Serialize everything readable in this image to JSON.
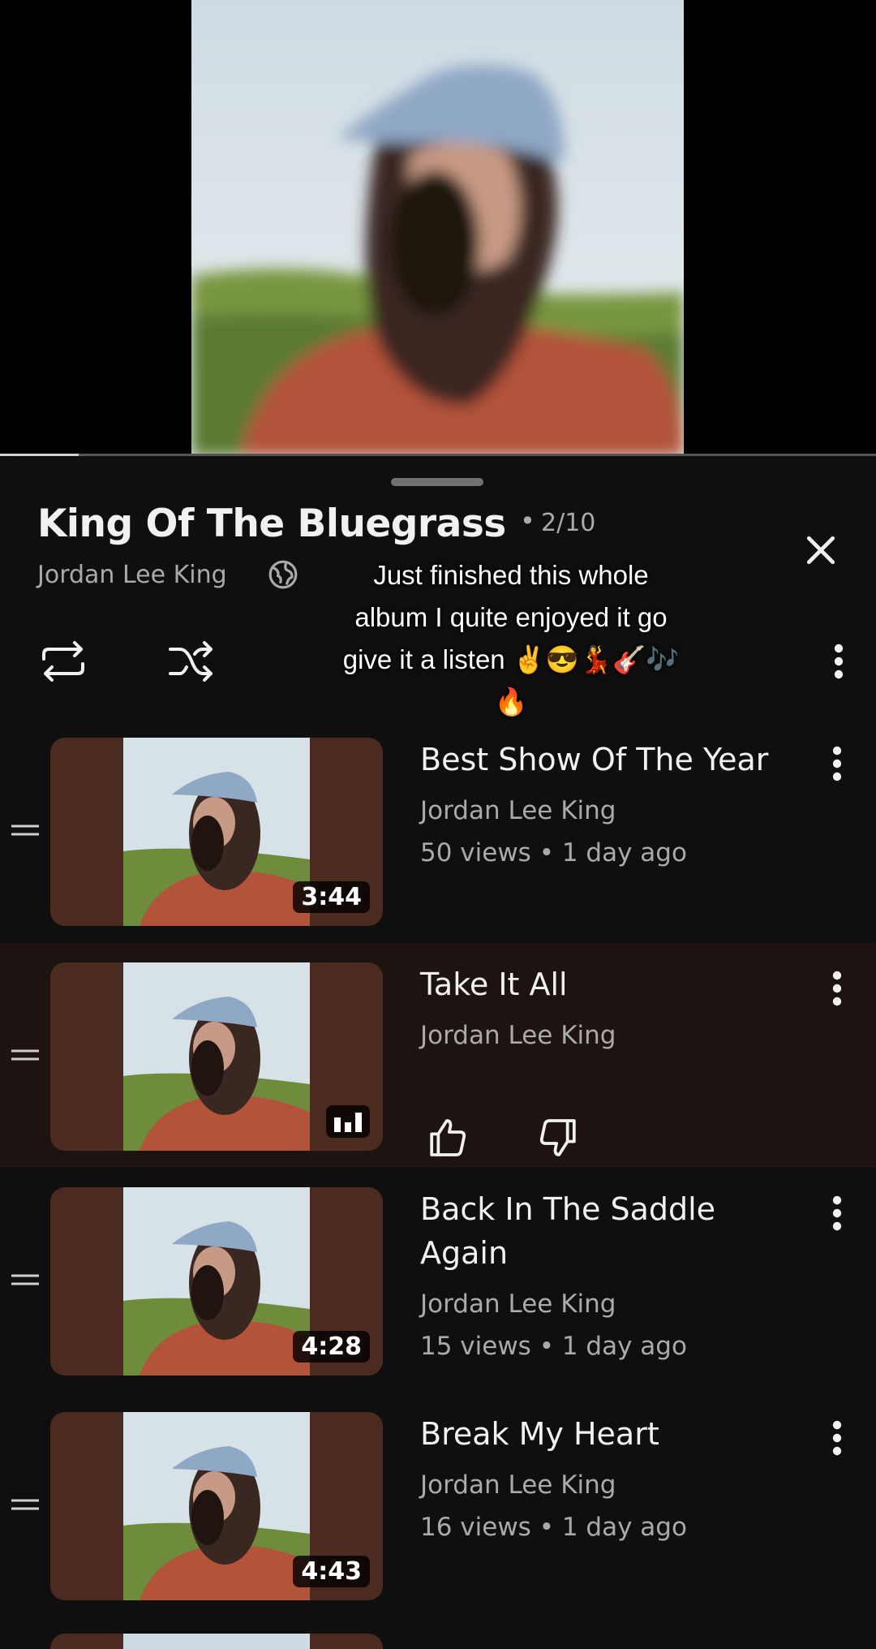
{
  "video": {
    "progress_fraction": 0.09
  },
  "playlist": {
    "title": "King Of The Bluegrass",
    "separator": "•",
    "position": "2/10",
    "artist": "Jordan Lee King",
    "icons": {
      "visibility": "globe-icon",
      "close": "close-icon",
      "repeat": "repeat-icon",
      "shuffle": "shuffle-icon",
      "more": "more-vert-icon"
    }
  },
  "caption": {
    "lines": [
      "Just finished this whole",
      "album I quite enjoyed it go",
      "give it a listen ✌😎💃🎸🎶",
      "🔥"
    ]
  },
  "tracks": [
    {
      "title": "Best Show Of The Year",
      "artist": "Jordan Lee King",
      "meta": "50 views • 1 day ago",
      "duration": "3:44",
      "playing": false
    },
    {
      "title": "Take It All",
      "artist": "Jordan Lee King",
      "meta": "",
      "duration": "",
      "playing": true
    },
    {
      "title": "Back In The Saddle Again",
      "artist": "Jordan Lee King",
      "meta": "15 views • 1 day ago",
      "duration": "4:28",
      "playing": false
    },
    {
      "title": "Break My Heart",
      "artist": "Jordan Lee King",
      "meta": "16 views • 1 day ago",
      "duration": "4:43",
      "playing": false
    }
  ],
  "colors": {
    "background": "#0f0f0f",
    "active_row": "#1d1412",
    "thumb_bg": "#4b2a1f",
    "secondary_text": "#aaaaaa"
  }
}
